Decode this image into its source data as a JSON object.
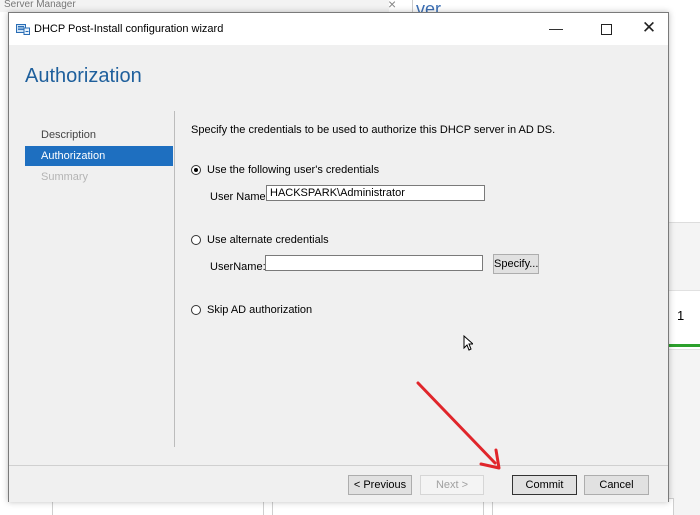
{
  "background": {
    "title": "Server Manager",
    "close_glyph": "×",
    "word_fragment": "ver",
    "tile_count": "1",
    "tile_accent": "#2ca02c"
  },
  "dialog": {
    "title": "DHCP Post-Install configuration wizard",
    "icon": "dhcp-wizard-icon",
    "window_controls": {
      "minimize": "—",
      "close": "✕"
    },
    "page_title": "Authorization",
    "accent": "#1e6fc0",
    "nav": [
      {
        "label": "Description",
        "state": "normal"
      },
      {
        "label": "Authorization",
        "state": "active"
      },
      {
        "label": "Summary",
        "state": "disabled"
      }
    ],
    "description": "Specify the credentials to be used to authorize this DHCP server in AD DS.",
    "options": {
      "current_user": {
        "label": "Use the following user's credentials",
        "checked": true,
        "field_label": "User Name:",
        "value": "HACKSPARK\\Administrator"
      },
      "alternate": {
        "label": "Use alternate credentials",
        "checked": false,
        "field_label": "UserName:",
        "value": "",
        "specify_button": "Specify..."
      },
      "skip": {
        "label": "Skip AD authorization",
        "checked": false
      }
    },
    "footer": {
      "previous": "< Previous",
      "next": "Next >",
      "commit": "Commit",
      "cancel": "Cancel"
    }
  },
  "annotation": {
    "arrow_color": "#e0262b"
  }
}
